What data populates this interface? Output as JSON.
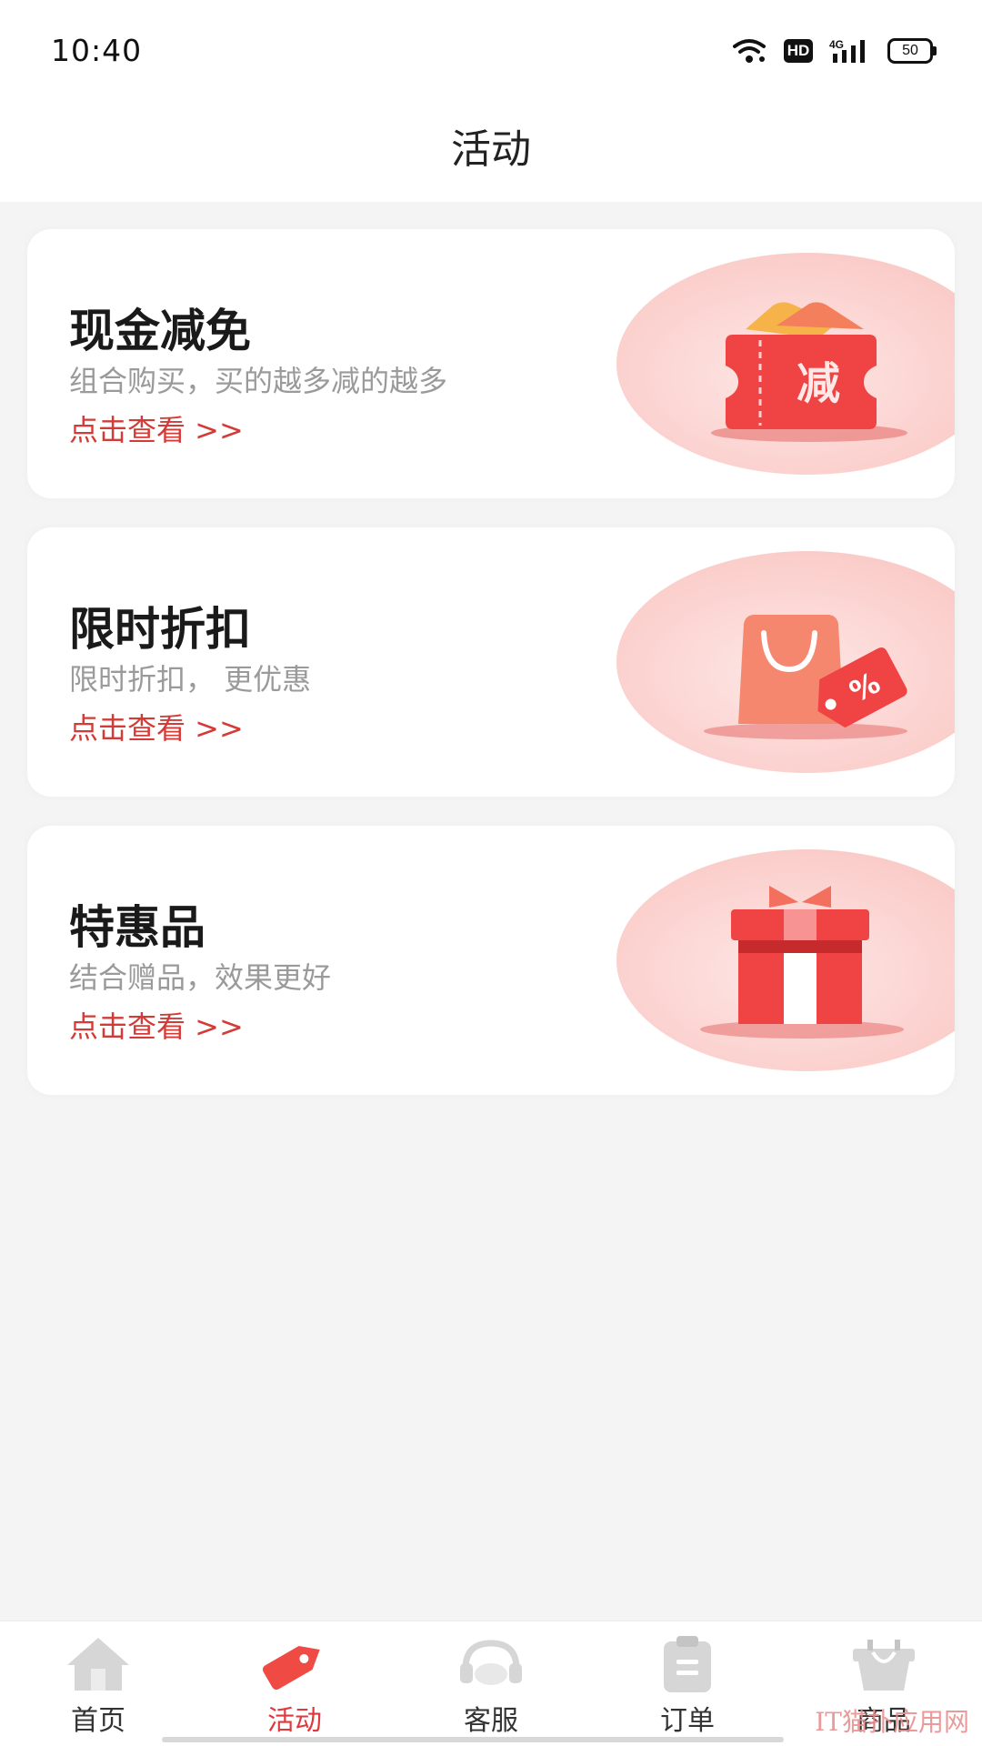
{
  "status_bar": {
    "time": "10:40",
    "hd_label": "HD",
    "network_label": "4G",
    "battery_level": "50",
    "icons": [
      "wifi-icon",
      "hd-icon",
      "signal-4g-icon",
      "battery-icon"
    ]
  },
  "header": {
    "title": "活动"
  },
  "colors": {
    "accent": "#e0383b",
    "link": "#d43a36",
    "blob": "#fbd2cf",
    "background": "#f4f4f4"
  },
  "cards": [
    {
      "title": "现金减免",
      "subtitle": "组合购买，买的越多减的越多",
      "link": "点击查看 >>",
      "icon": "coupon-icon",
      "icon_text": "减"
    },
    {
      "title": "限时折扣",
      "subtitle": "限时折扣， 更优惠",
      "link": "点击查看 >>",
      "icon": "shopping-bag-discount-icon",
      "icon_text": "%"
    },
    {
      "title": "特惠品",
      "subtitle": "结合赠品，效果更好",
      "link": "点击查看 >>",
      "icon": "gift-box-icon"
    }
  ],
  "tabs": [
    {
      "label": "首页",
      "icon": "home-icon",
      "active": false
    },
    {
      "label": "活动",
      "icon": "tag-icon",
      "active": true
    },
    {
      "label": "客服",
      "icon": "headset-icon",
      "active": false
    },
    {
      "label": "订单",
      "icon": "order-clipboard-icon",
      "active": false
    },
    {
      "label": "商品",
      "icon": "product-basket-icon",
      "active": false
    }
  ],
  "watermark": "IT猫扑应用网"
}
